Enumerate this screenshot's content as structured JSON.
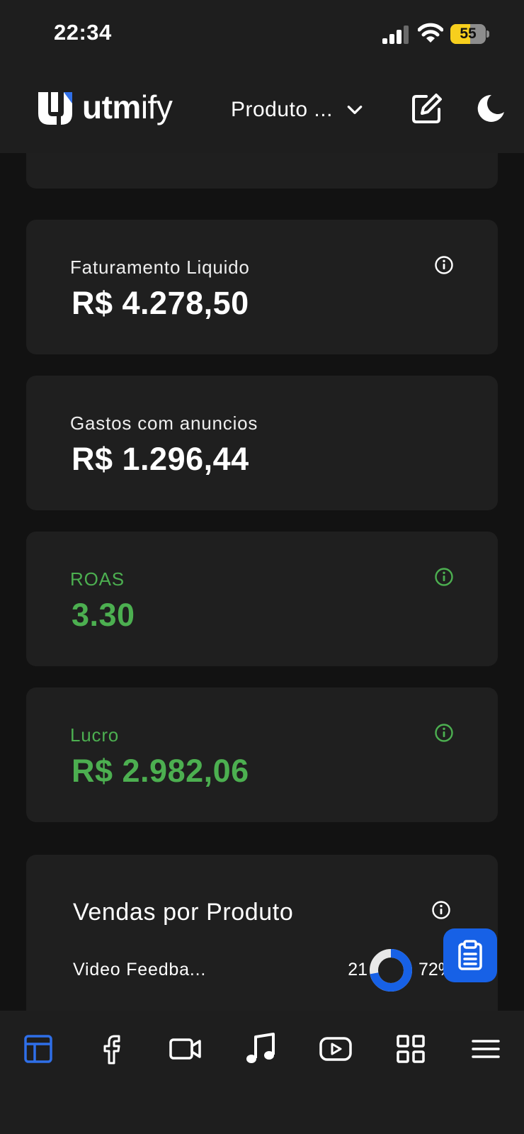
{
  "status_bar": {
    "time": "22:34",
    "battery_level": "55",
    "battery_fraction": 0.55
  },
  "header": {
    "logo_text_bold": "utm",
    "logo_text_light": "ify",
    "product_selector": "Produto ..."
  },
  "metrics": [
    {
      "label": "Faturamento Liquido",
      "value": "R$ 4.278,50",
      "color": "#ffffff",
      "has_info": true
    },
    {
      "label": "Gastos com anuncios",
      "value": "R$ 1.296,44",
      "color": "#ffffff",
      "has_info": false
    },
    {
      "label": "ROAS",
      "value": "3.30",
      "color": "#4caf50",
      "has_info": true
    },
    {
      "label": "Lucro",
      "value": "R$ 2.982,06",
      "color": "#4caf50",
      "has_info": true
    }
  ],
  "vendas": {
    "title": "Vendas por Produto",
    "rows": [
      {
        "name": "Video Feedba...",
        "count": "21",
        "percent": "72%",
        "fraction": 0.72
      }
    ]
  },
  "colors": {
    "accent": "#1761e6",
    "positive": "#4caf50",
    "card": "#1f1f1f",
    "background": "#121212"
  },
  "bottom_nav": [
    {
      "name": "dashboard-icon",
      "active": true
    },
    {
      "name": "facebook-icon",
      "active": false
    },
    {
      "name": "video-camera-icon",
      "active": false
    },
    {
      "name": "music-note-icon",
      "active": false
    },
    {
      "name": "youtube-icon",
      "active": false
    },
    {
      "name": "apps-grid-icon",
      "active": false
    },
    {
      "name": "menu-icon",
      "active": false
    }
  ]
}
